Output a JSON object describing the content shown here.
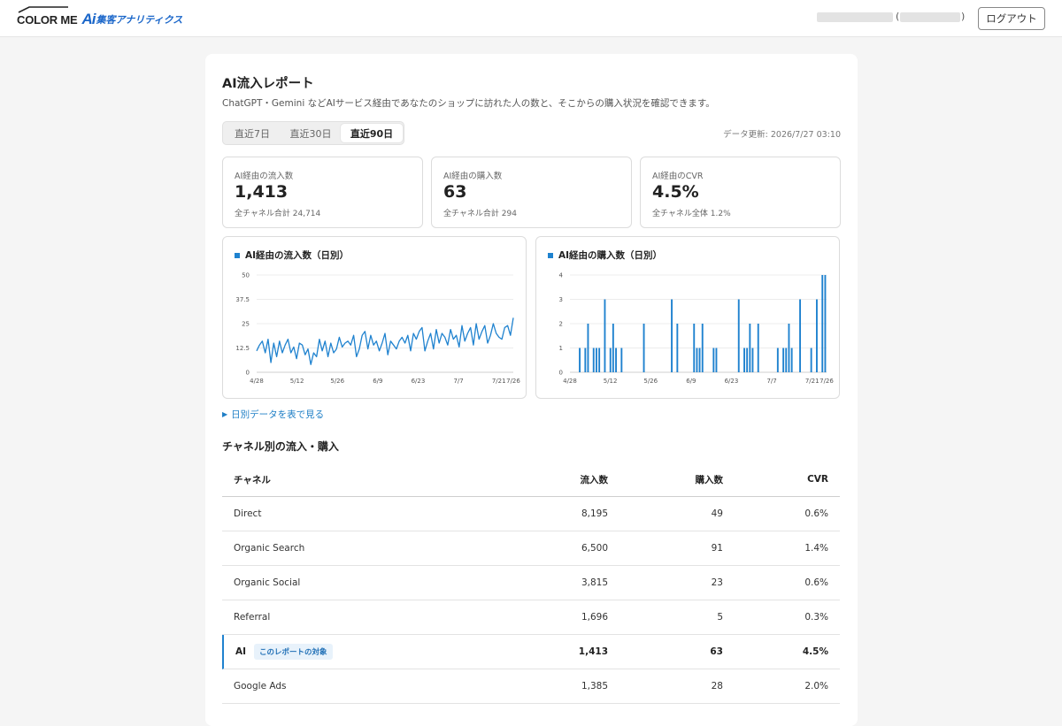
{
  "header": {
    "logo_text": "COLOR ME",
    "logo_ai": "Ai",
    "logo_product": "集客アナリティクス",
    "paren_open": "(",
    "paren_close": ")",
    "logout_label": "ログアウト"
  },
  "report": {
    "title": "AI流入レポート",
    "description": "ChatGPT・Gemini などAIサービス経由であなたのショップに訪れた人の数と、そこからの購入状況を確認できます。",
    "tabs": [
      {
        "label": "直近7日"
      },
      {
        "label": "直近30日"
      },
      {
        "label": "直近90日"
      }
    ],
    "active_tab": "直近90日",
    "updated": "データ更新: 2026/7/27 03:10"
  },
  "kpis": [
    {
      "label": "AI経由の流入数",
      "value": "1,413",
      "sub": "全チャネル合計 24,714"
    },
    {
      "label": "AI経由の購入数",
      "value": "63",
      "sub": "全チャネル合計 294"
    },
    {
      "label": "AI経由のCVR",
      "value": "4.5%",
      "sub": "全チャネル全体 1.2%"
    }
  ],
  "charts": {
    "visits_title": "AI経由の流入数（日別）",
    "purchases_title": "AI経由の購入数（日別）"
  },
  "chart_data": [
    {
      "type": "line",
      "title": "AI経由の流入数（日別）",
      "ylim": [
        0,
        50
      ],
      "yticks": [
        "0",
        "12.5",
        "25",
        "37.5",
        "50"
      ],
      "xticks": [
        "4/28",
        "5/12",
        "5/26",
        "6/9",
        "6/23",
        "7/7",
        "7/21",
        "7/26"
      ],
      "xstart": "4/28",
      "xend": "7/26",
      "color": "#1f82cf",
      "values": [
        11,
        14,
        16,
        10,
        17,
        5,
        15,
        8,
        16,
        10,
        14,
        17,
        10,
        13,
        7,
        15,
        14,
        9,
        12,
        4,
        10,
        8,
        17,
        11,
        16,
        8,
        15,
        10,
        12,
        18,
        13,
        15,
        16,
        14,
        19,
        8,
        12,
        19,
        21,
        12,
        19,
        14,
        16,
        11,
        15,
        20,
        9,
        16,
        14,
        12,
        16,
        18,
        15,
        19,
        11,
        20,
        17,
        21,
        23,
        11,
        16,
        20,
        12,
        22,
        15,
        20,
        18,
        14,
        22,
        17,
        19,
        13,
        24,
        16,
        20,
        23,
        14,
        25,
        17,
        21,
        24,
        15,
        19,
        25,
        20,
        18,
        17,
        23,
        24,
        19,
        28
      ]
    },
    {
      "type": "bar",
      "title": "AI経由の購入数（日別）",
      "ylim": [
        0,
        4
      ],
      "yticks": [
        "0",
        "1",
        "2",
        "3",
        "4"
      ],
      "xticks": [
        "4/28",
        "5/12",
        "5/26",
        "6/9",
        "6/23",
        "7/7",
        "7/21",
        "7/26"
      ],
      "xstart": "4/28",
      "xend": "7/26",
      "color": "#1f82cf",
      "values": [
        0,
        0,
        0,
        1,
        0,
        1,
        2,
        0,
        1,
        1,
        1,
        0,
        3,
        0,
        1,
        2,
        1,
        0,
        1,
        0,
        0,
        0,
        0,
        0,
        0,
        0,
        2,
        0,
        0,
        0,
        0,
        0,
        0,
        0,
        0,
        0,
        3,
        0,
        2,
        0,
        0,
        0,
        0,
        0,
        2,
        1,
        1,
        2,
        0,
        0,
        0,
        1,
        1,
        0,
        0,
        0,
        0,
        0,
        0,
        0,
        3,
        0,
        1,
        1,
        2,
        1,
        0,
        2,
        0,
        0,
        0,
        0,
        0,
        0,
        1,
        0,
        1,
        1,
        2,
        1,
        0,
        0,
        3,
        0,
        0,
        0,
        1,
        0,
        3,
        0,
        4,
        4
      ]
    }
  ],
  "daily_toggle": "日別データを表で見る",
  "channels": {
    "section_title": "チャネル別の流入・購入",
    "headers": {
      "channel": "チャネル",
      "visits": "流入数",
      "purchases": "購入数",
      "cvr": "CVR"
    },
    "rows": [
      {
        "channel": "Direct",
        "visits": "8,195",
        "purchases": "49",
        "cvr": "0.6%"
      },
      {
        "channel": "Organic Search",
        "visits": "6,500",
        "purchases": "91",
        "cvr": "1.4%"
      },
      {
        "channel": "Organic Social",
        "visits": "3,815",
        "purchases": "23",
        "cvr": "0.6%"
      },
      {
        "channel": "Referral",
        "visits": "1,696",
        "purchases": "5",
        "cvr": "0.3%"
      },
      {
        "channel": "AI",
        "badge": "このレポートの対象",
        "visits": "1,413",
        "purchases": "63",
        "cvr": "4.5%",
        "highlight": true
      },
      {
        "channel": "Google Ads",
        "visits": "1,385",
        "purchases": "28",
        "cvr": "2.0%"
      }
    ]
  }
}
